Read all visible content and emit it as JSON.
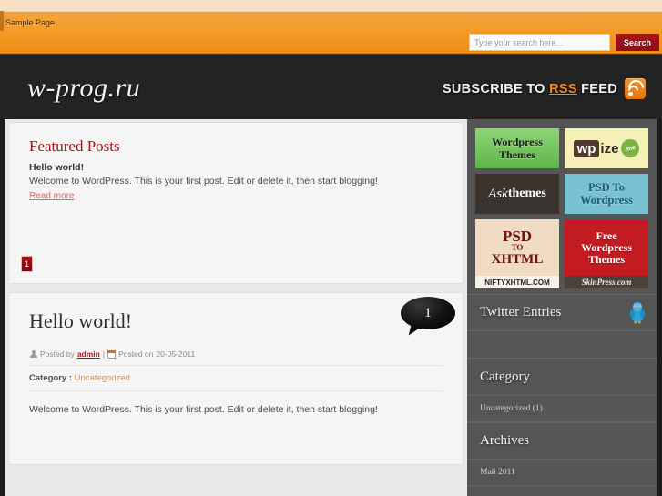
{
  "nav": {
    "items": [
      {
        "label": "Sample Page"
      }
    ]
  },
  "search": {
    "placeholder": "Type your search here...",
    "value": "",
    "button_label": "Search"
  },
  "header": {
    "site_title": "w-prog.ru",
    "rss_prefix": "SUBSCRIBE TO ",
    "rss_highlight": "RSS",
    "rss_suffix": " FEED",
    "rss_icon": "rss-icon"
  },
  "featured": {
    "heading": "Featured Posts",
    "post_title": "Hello world!",
    "post_excerpt": "Welcome to WordPress. This is your first post. Edit or delete it, then start blogging!",
    "read_more": "Read more",
    "pages": [
      "1"
    ]
  },
  "post": {
    "title": "Hello world!",
    "comment_count": "1",
    "posted_by_label": "Posted by",
    "author": "admin",
    "meta_separator": "|",
    "posted_on_label": "Posted on",
    "date": "20-05-2011",
    "category_label": "Category :",
    "category": "Uncategorized",
    "body": "Welcome to WordPress. This is your first post. Edit or delete it, then start blogging!",
    "user_icon": "user-icon",
    "calendar_icon": "calendar-icon"
  },
  "sidebar": {
    "ads": [
      {
        "id": "wordpress-themes",
        "line1": "Wordpress",
        "line2": "Themes"
      },
      {
        "id": "wpize",
        "part1": "wp",
        "part2": "ize",
        "part3": ".me"
      },
      {
        "id": "askthemes",
        "part1": "Ask",
        "part2": "themes"
      },
      {
        "id": "psd-to-wordpress",
        "line1": "PSD To",
        "line2": "Wordpress"
      },
      {
        "id": "psd-to-xhtml",
        "line1": "PSD",
        "line2": "TO",
        "line3": "XHTML",
        "footer": "NIFTYXHTML.COM"
      },
      {
        "id": "free-wordpress-themes",
        "line1": "Free",
        "line2": "Wordpress",
        "line3": "Themes",
        "footer": "SkinPress.com"
      }
    ],
    "widgets": [
      {
        "id": "twitter",
        "title": "Twitter Entries",
        "icon": "twitter-bird-icon",
        "items": []
      },
      {
        "id": "category",
        "title": "Category",
        "items": [
          "Uncategorized (1)"
        ]
      },
      {
        "id": "archives",
        "title": "Archives",
        "items": [
          "Май 2011"
        ]
      }
    ]
  },
  "colors": {
    "orange": "#f09020",
    "dark_red": "#a6141a",
    "header_dark": "#232323",
    "sidebar_gray": "#555555",
    "link_orange": "#f0882a"
  }
}
